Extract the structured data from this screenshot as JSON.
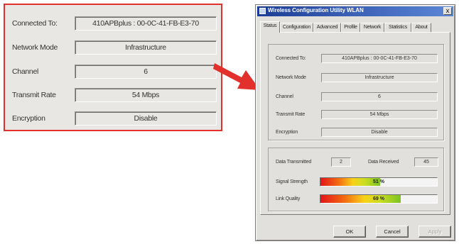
{
  "zoom_panel": {
    "rows": [
      {
        "label": "Connected To:",
        "value": "410APBplus : 00-0C-41-FB-E3-70"
      },
      {
        "label": "Network Mode",
        "value": "Infrastructure"
      },
      {
        "label": "Channel",
        "value": "6"
      },
      {
        "label": "Transmit Rate",
        "value": "54 Mbps"
      },
      {
        "label": "Encryption",
        "value": "Disable"
      }
    ],
    "border_color": "#e2302c"
  },
  "window": {
    "title": "Wireless Configuration Utility WLAN",
    "close_label": "x",
    "tabs": [
      {
        "label": "Status"
      },
      {
        "label": "Configuration"
      },
      {
        "label": "Advanced"
      },
      {
        "label": "Profile"
      },
      {
        "label": "Network"
      },
      {
        "label": "Statistics"
      },
      {
        "label": "About"
      }
    ],
    "active_tab": "Status",
    "status": {
      "connected_to_label": "Connected To:",
      "connected_to_value": "410APBplus : 00-0C-41-FB-E3-70",
      "network_mode_label": "Network Mode",
      "network_mode_value": "Infrastructure",
      "channel_label": "Channel",
      "channel_value": "6",
      "transmit_rate_label": "Transmit Rate",
      "transmit_rate_value": "54 Mbps",
      "encryption_label": "Encryption",
      "encryption_value": "Disable"
    },
    "stats": {
      "data_transmitted_label": "Data Transmitted",
      "data_transmitted_value": "2",
      "data_received_label": "Data Received",
      "data_received_value": "45",
      "signal_strength_label": "Signal Strength",
      "signal_strength_text": "51 %",
      "signal_strength_percent": 51,
      "link_quality_label": "Link Quality",
      "link_quality_text": "69 %",
      "link_quality_percent": 69
    },
    "buttons": {
      "ok": "OK",
      "cancel": "Cancel",
      "apply": "Apply"
    }
  },
  "arrow_color": "#e2302c"
}
